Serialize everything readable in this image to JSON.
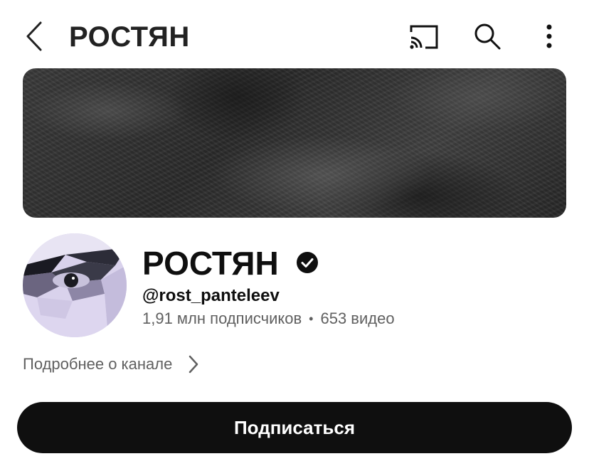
{
  "header": {
    "title": "РОСТЯН",
    "icons": [
      "back-arrow-icon",
      "cast-icon",
      "search-icon",
      "more-vert-icon"
    ]
  },
  "channel": {
    "name": "РОСТЯН",
    "handle": "@rost_panteleev",
    "subscribers": "1,91 млн подписчиков",
    "separator": "•",
    "videos": "653 видео",
    "more_info": "Подробнее о канале"
  },
  "actions": {
    "subscribe_label": "Подписаться"
  },
  "colors": {
    "primary_text": "#0f0f0f",
    "secondary_text": "#606060",
    "subscribe_bg": "#0f0f0f",
    "subscribe_text": "#ffffff"
  }
}
